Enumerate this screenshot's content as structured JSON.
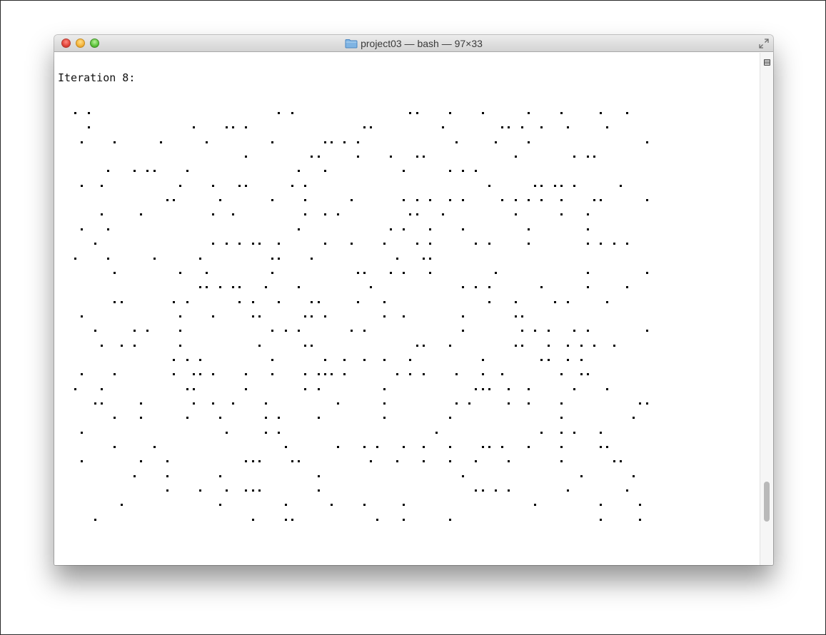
{
  "window": {
    "title": "project03 — bash — 97×33",
    "title_icon": "folder-icon",
    "controls": [
      "close-button",
      "minimize-button",
      "zoom-button",
      "fullscreen-icon"
    ]
  },
  "terminal": {
    "iteration_label": "Iteration 8:",
    "grid": {
      "columns": 97,
      "cells": [
        [
          0,
          1
        ],
        [
          0,
          3
        ],
        [
          0,
          32
        ],
        [
          0,
          34
        ],
        [
          0,
          52
        ],
        [
          0,
          53
        ],
        [
          0,
          58
        ],
        [
          0,
          63
        ],
        [
          0,
          70
        ],
        [
          0,
          75
        ],
        [
          0,
          81
        ],
        [
          0,
          85
        ],
        [
          1,
          3
        ],
        [
          1,
          19
        ],
        [
          1,
          24
        ],
        [
          1,
          25
        ],
        [
          1,
          27
        ],
        [
          1,
          45
        ],
        [
          1,
          46
        ],
        [
          1,
          57
        ],
        [
          1,
          66
        ],
        [
          1,
          67
        ],
        [
          1,
          69
        ],
        [
          1,
          72
        ],
        [
          1,
          76
        ],
        [
          1,
          82
        ],
        [
          2,
          2
        ],
        [
          2,
          7
        ],
        [
          2,
          14
        ],
        [
          2,
          21
        ],
        [
          2,
          31
        ],
        [
          2,
          39
        ],
        [
          2,
          40
        ],
        [
          2,
          42
        ],
        [
          2,
          44
        ],
        [
          2,
          59
        ],
        [
          2,
          65
        ],
        [
          2,
          70
        ],
        [
          2,
          88
        ],
        [
          3,
          27
        ],
        [
          3,
          37
        ],
        [
          3,
          38
        ],
        [
          3,
          44
        ],
        [
          3,
          49
        ],
        [
          3,
          53
        ],
        [
          3,
          54
        ],
        [
          3,
          68
        ],
        [
          3,
          77
        ],
        [
          3,
          79
        ],
        [
          3,
          80
        ],
        [
          4,
          6
        ],
        [
          4,
          10
        ],
        [
          4,
          12
        ],
        [
          4,
          13
        ],
        [
          4,
          18
        ],
        [
          4,
          35
        ],
        [
          4,
          39
        ],
        [
          4,
          51
        ],
        [
          4,
          58
        ],
        [
          4,
          60
        ],
        [
          4,
          62
        ],
        [
          5,
          2
        ],
        [
          5,
          5
        ],
        [
          5,
          17
        ],
        [
          5,
          22
        ],
        [
          5,
          26
        ],
        [
          5,
          27
        ],
        [
          5,
          34
        ],
        [
          5,
          36
        ],
        [
          5,
          64
        ],
        [
          5,
          71
        ],
        [
          5,
          72
        ],
        [
          5,
          74
        ],
        [
          5,
          75
        ],
        [
          5,
          77
        ],
        [
          5,
          84
        ],
        [
          6,
          15
        ],
        [
          6,
          16
        ],
        [
          6,
          23
        ],
        [
          6,
          31
        ],
        [
          6,
          36
        ],
        [
          6,
          43
        ],
        [
          6,
          51
        ],
        [
          6,
          53
        ],
        [
          6,
          55
        ],
        [
          6,
          58
        ],
        [
          6,
          60
        ],
        [
          6,
          66
        ],
        [
          6,
          68
        ],
        [
          6,
          70
        ],
        [
          6,
          72
        ],
        [
          6,
          75
        ],
        [
          6,
          80
        ],
        [
          6,
          81
        ],
        [
          6,
          88
        ],
        [
          7,
          5
        ],
        [
          7,
          11
        ],
        [
          7,
          22
        ],
        [
          7,
          25
        ],
        [
          7,
          36
        ],
        [
          7,
          39
        ],
        [
          7,
          41
        ],
        [
          7,
          52
        ],
        [
          7,
          53
        ],
        [
          7,
          57
        ],
        [
          7,
          68
        ],
        [
          7,
          75
        ],
        [
          7,
          79
        ],
        [
          8,
          2
        ],
        [
          8,
          6
        ],
        [
          8,
          35
        ],
        [
          8,
          49
        ],
        [
          8,
          51
        ],
        [
          8,
          55
        ],
        [
          8,
          60
        ],
        [
          8,
          70
        ],
        [
          8,
          79
        ],
        [
          9,
          4
        ],
        [
          9,
          22
        ],
        [
          9,
          24
        ],
        [
          9,
          26
        ],
        [
          9,
          28
        ],
        [
          9,
          29
        ],
        [
          9,
          32
        ],
        [
          9,
          39
        ],
        [
          9,
          43
        ],
        [
          9,
          48
        ],
        [
          9,
          53
        ],
        [
          9,
          55
        ],
        [
          9,
          62
        ],
        [
          9,
          64
        ],
        [
          9,
          70
        ],
        [
          9,
          79
        ],
        [
          9,
          81
        ],
        [
          9,
          83
        ],
        [
          9,
          85
        ],
        [
          10,
          1
        ],
        [
          10,
          6
        ],
        [
          10,
          13
        ],
        [
          10,
          20
        ],
        [
          10,
          31
        ],
        [
          10,
          32
        ],
        [
          10,
          37
        ],
        [
          10,
          50
        ],
        [
          10,
          54
        ],
        [
          10,
          55
        ],
        [
          11,
          7
        ],
        [
          11,
          17
        ],
        [
          11,
          21
        ],
        [
          11,
          31
        ],
        [
          11,
          44
        ],
        [
          11,
          45
        ],
        [
          11,
          49
        ],
        [
          11,
          51
        ],
        [
          11,
          55
        ],
        [
          11,
          65
        ],
        [
          11,
          79
        ],
        [
          11,
          88
        ],
        [
          12,
          20
        ],
        [
          12,
          21
        ],
        [
          12,
          23
        ],
        [
          12,
          25
        ],
        [
          12,
          26
        ],
        [
          12,
          30
        ],
        [
          12,
          35
        ],
        [
          12,
          46
        ],
        [
          12,
          60
        ],
        [
          12,
          62
        ],
        [
          12,
          64
        ],
        [
          12,
          72
        ],
        [
          12,
          79
        ],
        [
          12,
          85
        ],
        [
          13,
          7
        ],
        [
          13,
          8
        ],
        [
          13,
          16
        ],
        [
          13,
          18
        ],
        [
          13,
          26
        ],
        [
          13,
          28
        ],
        [
          13,
          32
        ],
        [
          13,
          37
        ],
        [
          13,
          38
        ],
        [
          13,
          44
        ],
        [
          13,
          48
        ],
        [
          13,
          64
        ],
        [
          13,
          68
        ],
        [
          13,
          74
        ],
        [
          13,
          76
        ],
        [
          13,
          82
        ],
        [
          14,
          2
        ],
        [
          14,
          17
        ],
        [
          14,
          22
        ],
        [
          14,
          28
        ],
        [
          14,
          29
        ],
        [
          14,
          36
        ],
        [
          14,
          37
        ],
        [
          14,
          39
        ],
        [
          14,
          48
        ],
        [
          14,
          51
        ],
        [
          14,
          60
        ],
        [
          14,
          68
        ],
        [
          14,
          69
        ],
        [
          15,
          4
        ],
        [
          15,
          10
        ],
        [
          15,
          12
        ],
        [
          15,
          17
        ],
        [
          15,
          31
        ],
        [
          15,
          33
        ],
        [
          15,
          35
        ],
        [
          15,
          43
        ],
        [
          15,
          45
        ],
        [
          15,
          60
        ],
        [
          15,
          69
        ],
        [
          15,
          71
        ],
        [
          15,
          73
        ],
        [
          15,
          77
        ],
        [
          15,
          79
        ],
        [
          15,
          88
        ],
        [
          16,
          5
        ],
        [
          16,
          8
        ],
        [
          16,
          10
        ],
        [
          16,
          17
        ],
        [
          16,
          29
        ],
        [
          16,
          36
        ],
        [
          16,
          37
        ],
        [
          16,
          53
        ],
        [
          16,
          54
        ],
        [
          16,
          58
        ],
        [
          16,
          68
        ],
        [
          16,
          69
        ],
        [
          16,
          73
        ],
        [
          16,
          76
        ],
        [
          16,
          78
        ],
        [
          16,
          80
        ],
        [
          16,
          83
        ],
        [
          17,
          16
        ],
        [
          17,
          18
        ],
        [
          17,
          20
        ],
        [
          17,
          31
        ],
        [
          17,
          39
        ],
        [
          17,
          42
        ],
        [
          17,
          45
        ],
        [
          17,
          48
        ],
        [
          17,
          52
        ],
        [
          17,
          63
        ],
        [
          17,
          72
        ],
        [
          17,
          73
        ],
        [
          17,
          76
        ],
        [
          17,
          78
        ],
        [
          18,
          2
        ],
        [
          18,
          7
        ],
        [
          18,
          16
        ],
        [
          18,
          19
        ],
        [
          18,
          20
        ],
        [
          18,
          22
        ],
        [
          18,
          27
        ],
        [
          18,
          31
        ],
        [
          18,
          36
        ],
        [
          18,
          38
        ],
        [
          18,
          39
        ],
        [
          18,
          40
        ],
        [
          18,
          42
        ],
        [
          18,
          50
        ],
        [
          18,
          52
        ],
        [
          18,
          54
        ],
        [
          18,
          59
        ],
        [
          18,
          63
        ],
        [
          18,
          66
        ],
        [
          18,
          75
        ],
        [
          18,
          78
        ],
        [
          18,
          79
        ],
        [
          19,
          1
        ],
        [
          19,
          5
        ],
        [
          19,
          18
        ],
        [
          19,
          19
        ],
        [
          19,
          27
        ],
        [
          19,
          36
        ],
        [
          19,
          38
        ],
        [
          19,
          48
        ],
        [
          19,
          62
        ],
        [
          19,
          63
        ],
        [
          19,
          64
        ],
        [
          19,
          67
        ],
        [
          19,
          70
        ],
        [
          19,
          77
        ],
        [
          19,
          82
        ],
        [
          20,
          4
        ],
        [
          20,
          5
        ],
        [
          20,
          11
        ],
        [
          20,
          19
        ],
        [
          20,
          22
        ],
        [
          20,
          25
        ],
        [
          20,
          30
        ],
        [
          20,
          41
        ],
        [
          20,
          48
        ],
        [
          20,
          59
        ],
        [
          20,
          61
        ],
        [
          20,
          67
        ],
        [
          20,
          70
        ],
        [
          20,
          75
        ],
        [
          20,
          87
        ],
        [
          20,
          88
        ],
        [
          21,
          7
        ],
        [
          21,
          11
        ],
        [
          21,
          18
        ],
        [
          21,
          23
        ],
        [
          21,
          30
        ],
        [
          21,
          32
        ],
        [
          21,
          38
        ],
        [
          21,
          48
        ],
        [
          21,
          58
        ],
        [
          21,
          75
        ],
        [
          21,
          86
        ],
        [
          22,
          2
        ],
        [
          22,
          24
        ],
        [
          22,
          30
        ],
        [
          22,
          32
        ],
        [
          22,
          56
        ],
        [
          22,
          72
        ],
        [
          22,
          75
        ],
        [
          22,
          77
        ],
        [
          22,
          81
        ],
        [
          23,
          7
        ],
        [
          23,
          13
        ],
        [
          23,
          33
        ],
        [
          23,
          41
        ],
        [
          23,
          45
        ],
        [
          23,
          47
        ],
        [
          23,
          51
        ],
        [
          23,
          54
        ],
        [
          23,
          58
        ],
        [
          23,
          63
        ],
        [
          23,
          64
        ],
        [
          23,
          66
        ],
        [
          23,
          70
        ],
        [
          23,
          75
        ],
        [
          23,
          81
        ],
        [
          23,
          82
        ],
        [
          24,
          2
        ],
        [
          24,
          11
        ],
        [
          24,
          15
        ],
        [
          24,
          27
        ],
        [
          24,
          28
        ],
        [
          24,
          29
        ],
        [
          24,
          34
        ],
        [
          24,
          35
        ],
        [
          24,
          46
        ],
        [
          24,
          50
        ],
        [
          24,
          54
        ],
        [
          24,
          58
        ],
        [
          24,
          62
        ],
        [
          24,
          67
        ],
        [
          24,
          75
        ],
        [
          24,
          83
        ],
        [
          24,
          84
        ],
        [
          25,
          10
        ],
        [
          25,
          15
        ],
        [
          25,
          23
        ],
        [
          25,
          38
        ],
        [
          25,
          60
        ],
        [
          25,
          78
        ],
        [
          25,
          86
        ],
        [
          26,
          15
        ],
        [
          26,
          20
        ],
        [
          26,
          24
        ],
        [
          26,
          27
        ],
        [
          26,
          28
        ],
        [
          26,
          29
        ],
        [
          26,
          38
        ],
        [
          26,
          62
        ],
        [
          26,
          63
        ],
        [
          26,
          65
        ],
        [
          26,
          67
        ],
        [
          26,
          76
        ],
        [
          26,
          85
        ],
        [
          27,
          8
        ],
        [
          27,
          23
        ],
        [
          27,
          33
        ],
        [
          27,
          40
        ],
        [
          27,
          45
        ],
        [
          27,
          51
        ],
        [
          27,
          71
        ],
        [
          27,
          81
        ],
        [
          27,
          87
        ],
        [
          28,
          4
        ],
        [
          28,
          28
        ],
        [
          28,
          33
        ],
        [
          28,
          34
        ],
        [
          28,
          47
        ],
        [
          28,
          51
        ],
        [
          28,
          58
        ],
        [
          28,
          81
        ],
        [
          28,
          87
        ]
      ]
    }
  }
}
